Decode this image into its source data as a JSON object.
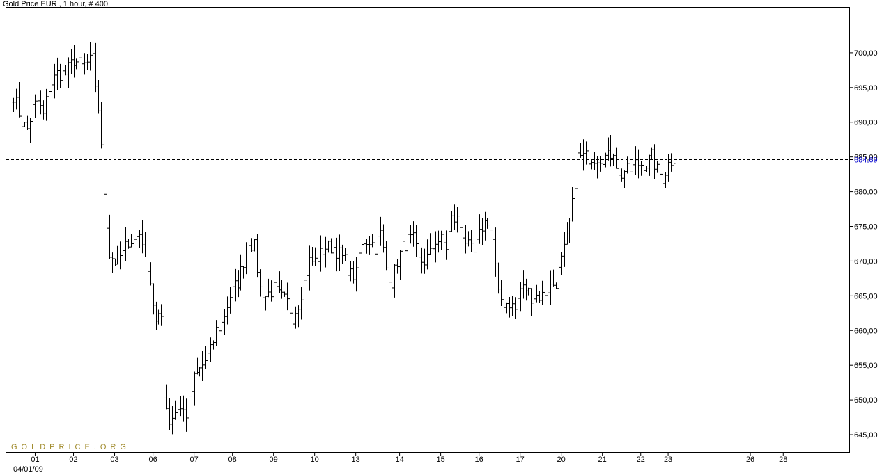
{
  "title": "Gold Price EUR , 1 hour, # 400",
  "watermark": "GOLDPRICE.ORG",
  "date_caption": "04/01/09",
  "colors": {
    "bars": "#000000",
    "frame": "#000000",
    "current_price": "#0000cc",
    "watermark": "#a08a2a"
  },
  "chart_data": {
    "type": "ohlc",
    "title": "Gold Price EUR , 1 hour, # 400",
    "xlabel": "",
    "ylabel": "",
    "ylim": [
      642.5,
      706.5
    ],
    "y_ticks": [
      "700,00",
      "695,00",
      "690,00",
      "685,00",
      "680,00",
      "675,00",
      "670,00",
      "665,00",
      "660,00",
      "655,00",
      "650,00",
      "645,00"
    ],
    "y_tick_values": [
      700,
      695,
      690,
      685,
      680,
      675,
      670,
      665,
      660,
      655,
      650,
      645
    ],
    "x_ticks": [
      "01",
      "02",
      "03",
      "06",
      "07",
      "08",
      "09",
      "10",
      "13",
      "14",
      "15",
      "16",
      "17",
      "20",
      "21",
      "22",
      "23",
      "26",
      "28"
    ],
    "x_tick_slots": [
      8,
      22,
      37,
      51,
      66,
      80,
      95,
      110,
      125,
      141,
      156,
      170,
      185,
      200,
      215,
      229,
      239,
      269,
      281
    ],
    "slot_count": 300,
    "current_price": 684.69,
    "current_price_label": "684,69",
    "anchors": [
      [
        0,
        694
      ],
      [
        3,
        690
      ],
      [
        5,
        689
      ],
      [
        7,
        692
      ],
      [
        9,
        693
      ],
      [
        11,
        691
      ],
      [
        13,
        695
      ],
      [
        16,
        697
      ],
      [
        19,
        697
      ],
      [
        22,
        699
      ],
      [
        25,
        698
      ],
      [
        29,
        699
      ],
      [
        31,
        692
      ],
      [
        33,
        680
      ],
      [
        35,
        671
      ],
      [
        37,
        670
      ],
      [
        40,
        671
      ],
      [
        42,
        673
      ],
      [
        44,
        673
      ],
      [
        46,
        674
      ],
      [
        48,
        672
      ],
      [
        50,
        667
      ],
      [
        52,
        661
      ],
      [
        54,
        662
      ],
      [
        55,
        651
      ],
      [
        57,
        647
      ],
      [
        60,
        649
      ],
      [
        63,
        648
      ],
      [
        66,
        653
      ],
      [
        69,
        655
      ],
      [
        72,
        657
      ],
      [
        74,
        660
      ],
      [
        76,
        661
      ],
      [
        79,
        665
      ],
      [
        82,
        667
      ],
      [
        84,
        670
      ],
      [
        86,
        673
      ],
      [
        88,
        672
      ],
      [
        90,
        666
      ],
      [
        92,
        665
      ],
      [
        95,
        666
      ],
      [
        97,
        665
      ],
      [
        100,
        664
      ],
      [
        102,
        662
      ],
      [
        104,
        664
      ],
      [
        106,
        667
      ],
      [
        108,
        670
      ],
      [
        110,
        670
      ],
      [
        112,
        671
      ],
      [
        114,
        672
      ],
      [
        117,
        672
      ],
      [
        119,
        671
      ],
      [
        121,
        670
      ],
      [
        123,
        668
      ],
      [
        125,
        668
      ],
      [
        126,
        671
      ],
      [
        128,
        673
      ],
      [
        130,
        673
      ],
      [
        132,
        672
      ],
      [
        134,
        674
      ],
      [
        136,
        669
      ],
      [
        138,
        667
      ],
      [
        140,
        670
      ],
      [
        142,
        672
      ],
      [
        144,
        673
      ],
      [
        146,
        673
      ],
      [
        148,
        670
      ],
      [
        150,
        670
      ],
      [
        152,
        671
      ],
      [
        154,
        673
      ],
      [
        156,
        673
      ],
      [
        158,
        672
      ],
      [
        160,
        676
      ],
      [
        162,
        676
      ],
      [
        164,
        674
      ],
      [
        166,
        672
      ],
      [
        168,
        671
      ],
      [
        171,
        675
      ],
      [
        173,
        676
      ],
      [
        175,
        673
      ],
      [
        177,
        665
      ],
      [
        179,
        664
      ],
      [
        181,
        664
      ],
      [
        183,
        663
      ],
      [
        185,
        666
      ],
      [
        187,
        666
      ],
      [
        189,
        665
      ],
      [
        191,
        665
      ],
      [
        193,
        665
      ],
      [
        195,
        666
      ],
      [
        198,
        667
      ],
      [
        200,
        670
      ],
      [
        202,
        673
      ],
      [
        204,
        678
      ],
      [
        206,
        685
      ],
      [
        209,
        685
      ],
      [
        211,
        685
      ],
      [
        213,
        685
      ],
      [
        215,
        685
      ],
      [
        217,
        685
      ],
      [
        219,
        686
      ],
      [
        221,
        682
      ],
      [
        223,
        683
      ],
      [
        225,
        683
      ],
      [
        227,
        684
      ],
      [
        229,
        684
      ],
      [
        231,
        684
      ],
      [
        233,
        685
      ],
      [
        235,
        683
      ],
      [
        237,
        682
      ],
      [
        239,
        684
      ],
      [
        241,
        685
      ]
    ]
  }
}
